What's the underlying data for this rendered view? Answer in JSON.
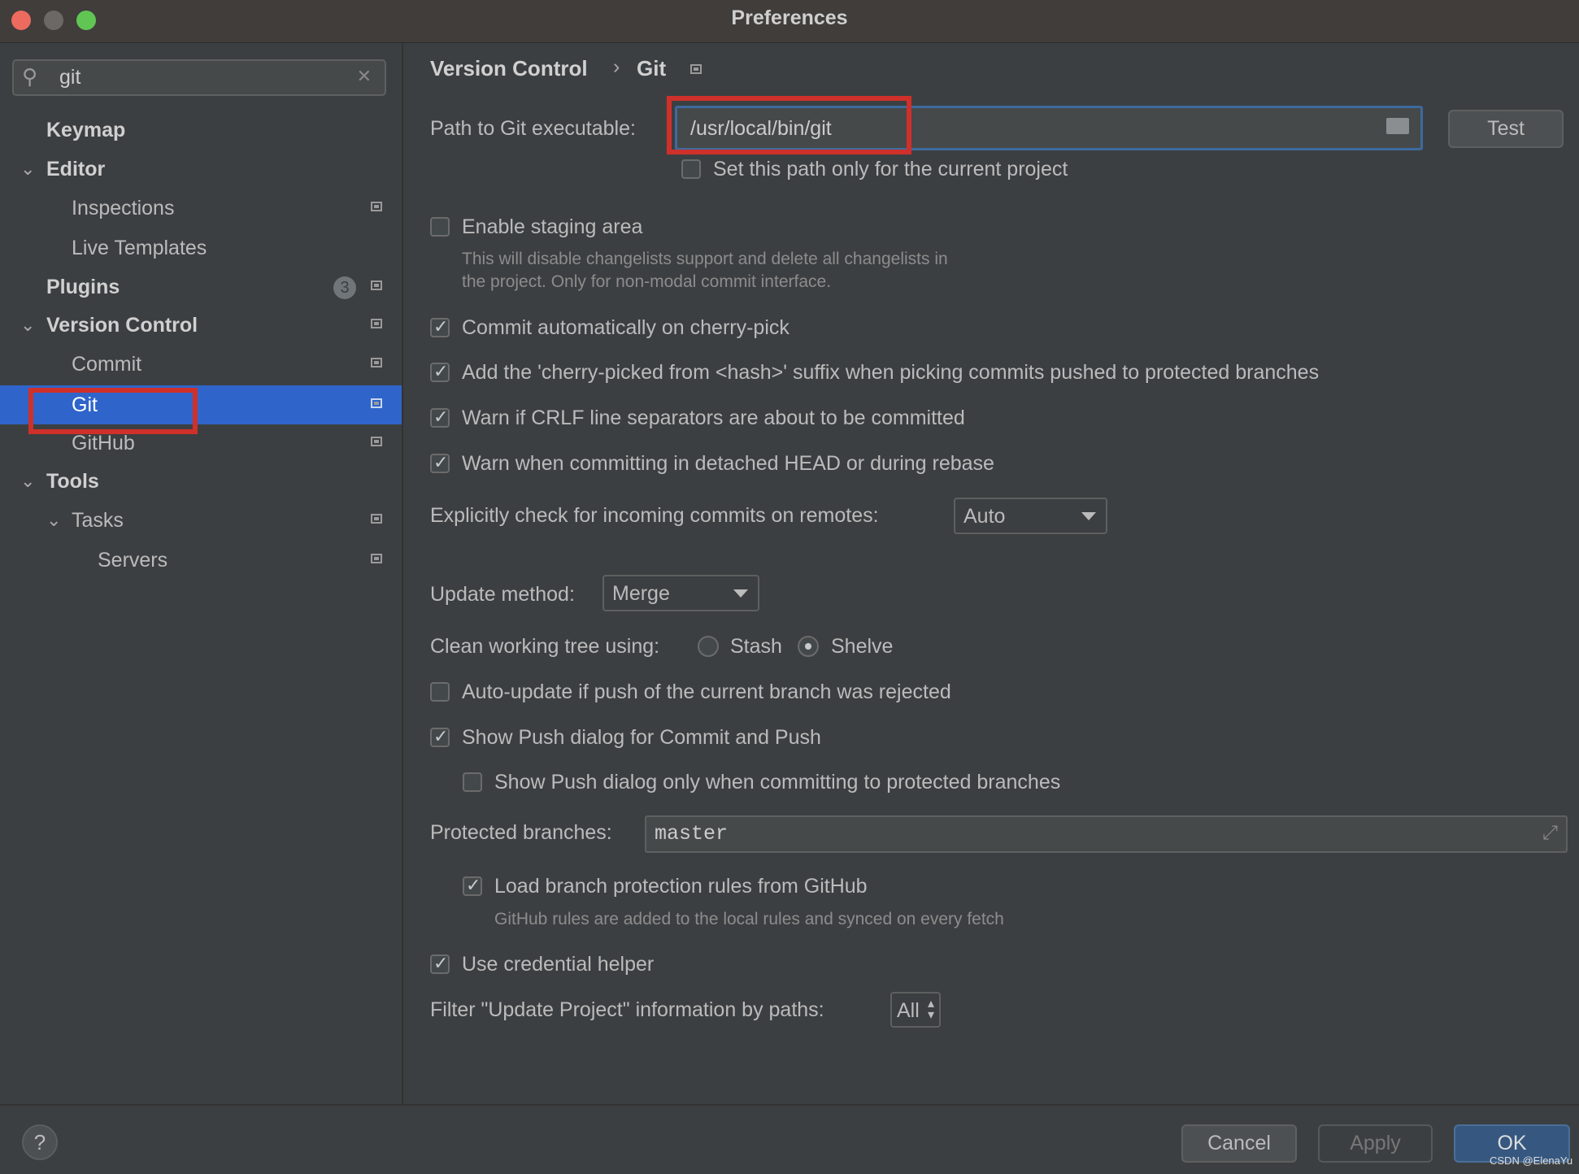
{
  "window": {
    "title": "Preferences"
  },
  "search": {
    "value": "git"
  },
  "sidebar": {
    "items": [
      {
        "label": "Keymap"
      },
      {
        "label": "Editor"
      },
      {
        "label": "Inspections"
      },
      {
        "label": "Live Templates"
      },
      {
        "label": "Plugins",
        "badge": "3"
      },
      {
        "label": "Version Control"
      },
      {
        "label": "Commit"
      },
      {
        "label": "Git",
        "selected": true
      },
      {
        "label": "GitHub"
      },
      {
        "label": "Tools"
      },
      {
        "label": "Tasks"
      },
      {
        "label": "Servers"
      }
    ]
  },
  "breadcrumb": {
    "parent": "Version Control",
    "separator": "›",
    "current": "Git"
  },
  "git_path": {
    "label": "Path to Git executable:",
    "value": "/usr/local/bin/git",
    "test_label": "Test",
    "project_only_label": "Set this path only for the current project",
    "project_only_checked": false
  },
  "staging": {
    "label": "Enable staging area",
    "checked": false,
    "desc1": "This will disable changelists support and delete all changelists in",
    "desc2": "the project. Only for non-modal commit interface."
  },
  "options": [
    {
      "label": "Commit automatically on cherry-pick",
      "checked": true
    },
    {
      "label": "Add the 'cherry-picked from <hash>' suffix when picking commits pushed to protected branches",
      "checked": true
    },
    {
      "label": "Warn if CRLF line separators are about to be committed",
      "checked": true
    },
    {
      "label": "Warn when committing in detached HEAD or during rebase",
      "checked": true
    }
  ],
  "incoming": {
    "label": "Explicitly check for incoming commits on remotes:",
    "value": "Auto"
  },
  "update_method": {
    "label": "Update method:",
    "value": "Merge"
  },
  "clean_tree": {
    "label": "Clean working tree using:",
    "options": [
      "Stash",
      "Shelve"
    ],
    "selected": "Shelve"
  },
  "auto_update": {
    "label": "Auto-update if push of the current branch was rejected",
    "checked": false
  },
  "show_push": {
    "label": "Show Push dialog for Commit and Push",
    "checked": true
  },
  "show_push_protected": {
    "label": "Show Push dialog only when committing to protected branches",
    "checked": false
  },
  "protected": {
    "label": "Protected branches:",
    "value": "master"
  },
  "load_rules": {
    "label": "Load branch protection rules from GitHub",
    "checked": true,
    "desc": "GitHub rules are added to the local rules and synced on every fetch"
  },
  "credential": {
    "label": "Use credential helper",
    "checked": true
  },
  "filter": {
    "label": "Filter \"Update Project\" information by paths:",
    "value": "All"
  },
  "footer": {
    "help": "?",
    "cancel": "Cancel",
    "apply": "Apply",
    "ok": "OK",
    "watermark": "CSDN @ElenaYu"
  },
  "colors": {
    "selection": "#2f65ca",
    "highlight_box": "#d0302a",
    "ok_button": "#365880"
  }
}
